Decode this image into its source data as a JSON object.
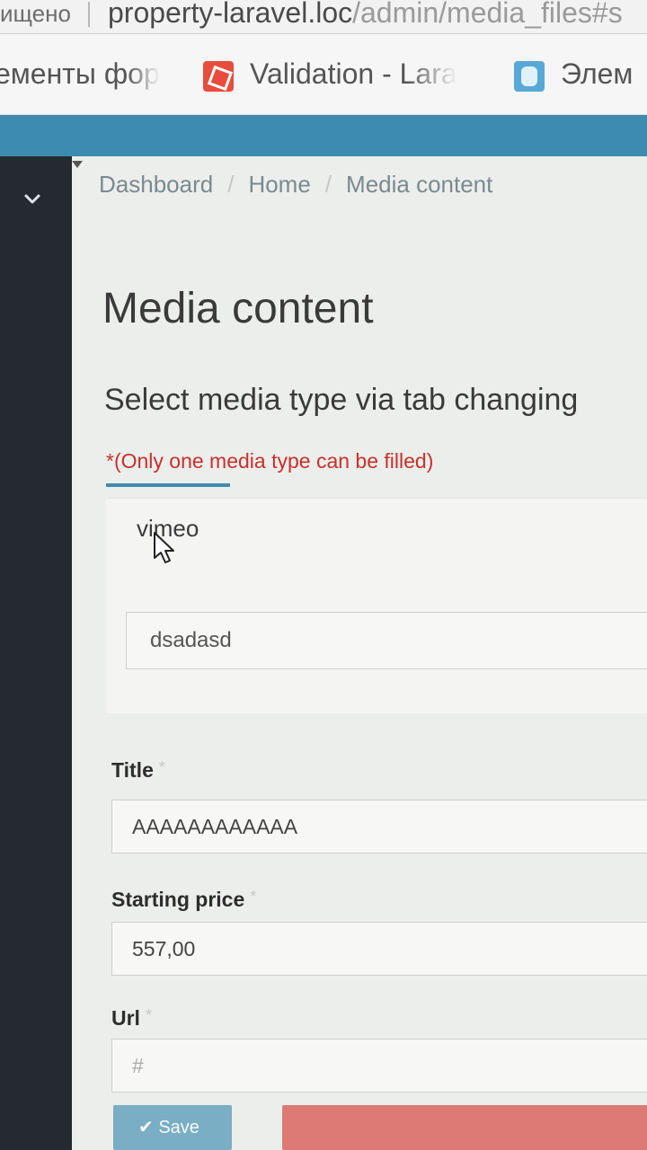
{
  "browser": {
    "security_text": "ищено",
    "url_host": "property-laravel.loc",
    "url_path": "/admin/media_files#s",
    "bookmarks": [
      {
        "label": "ементы фор",
        "icon": "bookmark-page-icon"
      },
      {
        "label": "Validation - Lara",
        "icon": "laravel-icon"
      },
      {
        "label": "Элем",
        "icon": "elements-icon"
      }
    ]
  },
  "breadcrumb": [
    "Dashboard",
    "Home",
    "Media content"
  ],
  "page": {
    "title": "Media content",
    "subtitle": "Select media type via tab changing",
    "hint": "*(Only one media type can be filled)"
  },
  "tab": {
    "active_label": "vimeo",
    "input_value": "dsadasd"
  },
  "form": {
    "title_label": "Title",
    "title_value": "AAAAAAAAAAAA",
    "price_label": "Starting price",
    "price_value": "557,00",
    "url_label": "Url",
    "url_placeholder": "#",
    "required_mark": "*"
  },
  "buttons": {
    "save_label": "Save"
  },
  "colors": {
    "accent": "#3d8cb0",
    "sidebar": "#242a30",
    "error": "#c9302c",
    "danger": "#d9534f"
  }
}
